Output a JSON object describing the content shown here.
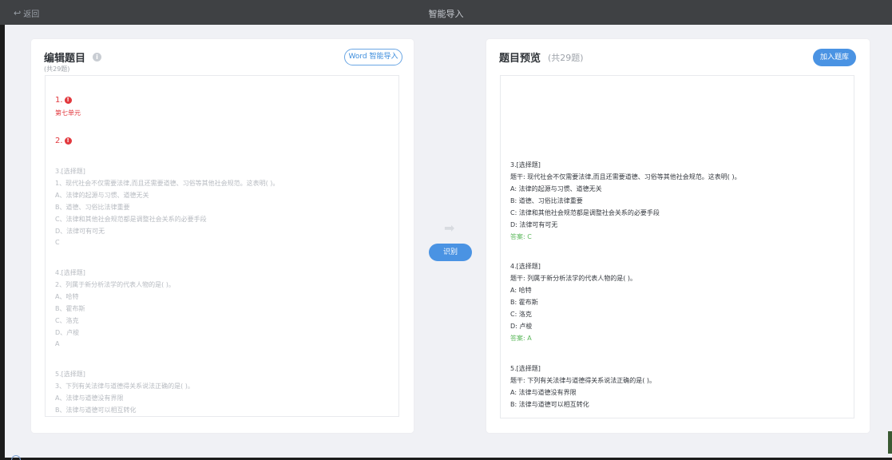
{
  "topbar": {
    "back_label": "返回",
    "title": "智能导入"
  },
  "left": {
    "title": "编辑题目",
    "subtitle": "(共29题)",
    "word_button": "Word 智能导入",
    "lines": [
      "1.",
      "第七单元",
      "2.",
      "3.[选择题]",
      "1、现代社会不仅需要法律,而且还需要道德、习俗等其他社会规范。这表明( )。",
      "A、法律的起源与习惯、道德无关",
      "B、道德、习俗比法律重要",
      "C、法律和其他社会规范都是调整社会关系的必要手段",
      "D、法律可有可无",
      "C",
      "4.[选择题]",
      "2、列属于新分析法学的代表人物的是( )。",
      "A、哈特",
      "B、霍布斯",
      "C、洛克",
      "D、卢梭",
      "A",
      "5.[选择题]",
      "3、下列有关法律与道德得关系说法正确的是( )。",
      "A、法律与道德没有界限",
      "B、法律与道德可以相互转化"
    ]
  },
  "middle": {
    "recognize_button": "识别"
  },
  "right": {
    "title": "题目预览",
    "count": "(共29题)",
    "add_button": "加入题库",
    "lines": [
      "3.[选择题]",
      "题干: 现代社会不仅需要法律,而且还需要道德、习俗等其他社会规范。这表明( )。",
      "A: 法律的起源与习惯、道德无关",
      "B: 道德、习俗比法律重要",
      "C: 法律和其他社会规范都是调整社会关系的必要手段",
      "D: 法律可有可无",
      "答案: C",
      "4.[选择题]",
      "题干: 列属于新分析法学的代表人物的是( )。",
      "A: 哈特",
      "B: 霍布斯",
      "C: 洛克",
      "D: 卢梭",
      "答案: A",
      "5.[选择题]",
      "题干: 下列有关法律与道德得关系说法正确的是( )。",
      "A: 法律与道德没有界限",
      "B: 法律与道德可以相互转化"
    ]
  },
  "colors": {
    "accent": "#4a93e3",
    "error": "#e2383d",
    "answer": "#5cb85c",
    "topbar": "#3f4144"
  }
}
